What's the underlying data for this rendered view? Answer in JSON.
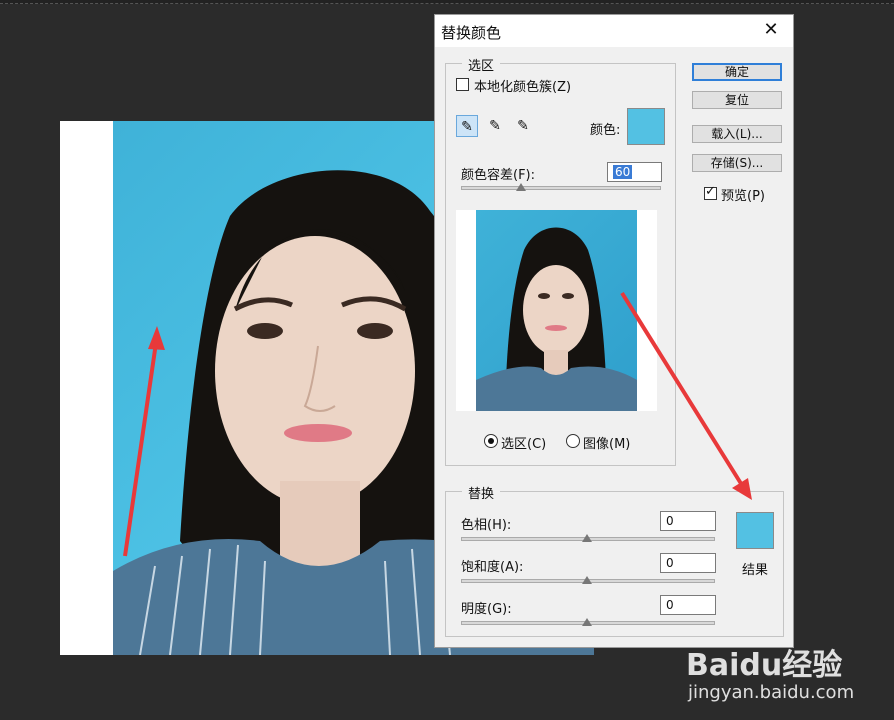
{
  "dialog": {
    "title": "替换颜色",
    "close_icon": "close-icon",
    "selection": {
      "legend": "选区",
      "localized_clusters_label": "本地化颜色簇(Z)",
      "localized_clusters_checked": false,
      "color_label": "颜色:",
      "color_swatch": "#53c1e3",
      "fuzziness_label": "颜色容差(F):",
      "fuzziness_value": "60",
      "fuzziness_level": 0.3,
      "radio_selection_label": "选区(C)",
      "radio_image_label": "图像(M)",
      "radio_selected": "selection"
    },
    "buttons": {
      "ok": "确定",
      "reset": "复位",
      "load": "载入(L)...",
      "save": "存储(S)..."
    },
    "preview_label": "预览(P)",
    "preview_checked": true,
    "replacement": {
      "legend": "替换",
      "hue_label": "色相(H):",
      "hue_value": "0",
      "saturation_label": "饱和度(A):",
      "saturation_value": "0",
      "lightness_label": "明度(G):",
      "lightness_value": "0",
      "result_label": "结果",
      "result_swatch": "#53c1e3"
    }
  },
  "watermark": {
    "brand": "Baidu经验",
    "url": "jingyan.baidu.com"
  }
}
